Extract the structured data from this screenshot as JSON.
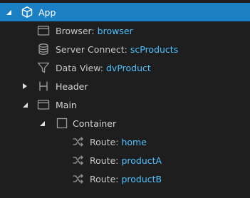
{
  "tree": {
    "app": {
      "label": "App"
    },
    "browser": {
      "key": "Browser:",
      "value": "browser"
    },
    "server_connect": {
      "key": "Server Connect:",
      "value": "scProducts"
    },
    "data_view": {
      "key": "Data View:",
      "value": "dvProduct"
    },
    "header": {
      "label": "Header"
    },
    "main": {
      "label": "Main"
    },
    "container": {
      "label": "Container"
    },
    "routes": [
      {
        "key": "Route:",
        "value": "home"
      },
      {
        "key": "Route:",
        "value": "productA"
      },
      {
        "key": "Route:",
        "value": "productB"
      }
    ]
  },
  "colors": {
    "selection": "#1b7fc4",
    "value_text": "#4fc1ff",
    "background": "#1e1e1e"
  },
  "icons": {
    "app": "cube-icon",
    "browser": "browser-window-icon",
    "server_connect": "database-icon",
    "data_view": "filter-icon",
    "header": "header-h-icon",
    "main": "section-icon",
    "container": "container-square-icon",
    "route": "shuffle-route-icon"
  }
}
